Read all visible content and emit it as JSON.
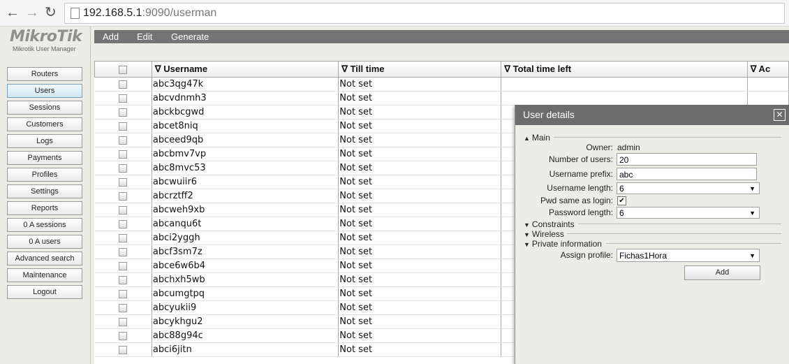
{
  "browser": {
    "back_icon": "arrow-left",
    "forward_icon": "arrow-right",
    "reload_icon": "reload",
    "url_host": "192.168.5.1",
    "url_rest": ":9090/userman"
  },
  "app": {
    "logo": "MikroTik",
    "subtitle": "Mikrotik User Manager"
  },
  "sidebar": {
    "items": [
      {
        "label": "Routers",
        "active": false
      },
      {
        "label": "Users",
        "active": true
      },
      {
        "label": "Sessions",
        "active": false
      },
      {
        "label": "Customers",
        "active": false
      },
      {
        "label": "Logs",
        "active": false
      },
      {
        "label": "Payments",
        "active": false
      },
      {
        "label": "Profiles",
        "active": false
      },
      {
        "label": "Settings",
        "active": false
      },
      {
        "label": "Reports",
        "active": false
      },
      {
        "label": "0 A sessions",
        "active": false
      },
      {
        "label": "0 A users",
        "active": false
      },
      {
        "label": "Advanced search",
        "active": false
      },
      {
        "label": "Maintenance",
        "active": false
      },
      {
        "label": "Logout",
        "active": false
      }
    ]
  },
  "toolbar": {
    "add_label": "Add",
    "edit_label": "Edit",
    "generate_label": "Generate"
  },
  "table": {
    "columns": [
      "∇ Username",
      "∇ Till time",
      "∇ Total time left",
      "∇ Ac"
    ],
    "rows": [
      {
        "username": "abc3qg47k",
        "till_time": "Not set"
      },
      {
        "username": "abcvdnmh3",
        "till_time": "Not set"
      },
      {
        "username": "abckbcgwd",
        "till_time": "Not set"
      },
      {
        "username": "abcet8niq",
        "till_time": "Not set"
      },
      {
        "username": "abceed9qb",
        "till_time": "Not set"
      },
      {
        "username": "abcbmv7vp",
        "till_time": "Not set"
      },
      {
        "username": "abc8mvc53",
        "till_time": "Not set"
      },
      {
        "username": "abcwuiir6",
        "till_time": "Not set"
      },
      {
        "username": "abcrztff2",
        "till_time": "Not set"
      },
      {
        "username": "abcweh9xb",
        "till_time": "Not set"
      },
      {
        "username": "abcanqu6t",
        "till_time": "Not set"
      },
      {
        "username": "abci2yggh",
        "till_time": "Not set"
      },
      {
        "username": "abcf3sm7z",
        "till_time": "Not set"
      },
      {
        "username": "abce6w6b4",
        "till_time": "Not set"
      },
      {
        "username": "abchxh5wb",
        "till_time": "Not set"
      },
      {
        "username": "abcumgtpq",
        "till_time": "Not set"
      },
      {
        "username": "abcyukii9",
        "till_time": "Not set"
      },
      {
        "username": "abcykhgu2",
        "till_time": "Not set"
      },
      {
        "username": "abc88g94c",
        "till_time": "Not set"
      },
      {
        "username": "abci6jitn",
        "till_time": "Not set"
      }
    ]
  },
  "dialog": {
    "title": "User details",
    "close_glyph": "✕",
    "sections": {
      "main": "Main",
      "constraints": "Constraints",
      "wireless": "Wireless",
      "private": "Private information"
    },
    "fields": {
      "owner_label": "Owner:",
      "owner_value": "admin",
      "num_users_label": "Number of users:",
      "num_users_value": "20",
      "prefix_label": "Username prefix:",
      "prefix_value": "abc",
      "uname_len_label": "Username length:",
      "uname_len_value": "6",
      "pwd_same_label": "Pwd same as login:",
      "pwd_same_checked": "✔",
      "pwd_len_label": "Password length:",
      "pwd_len_value": "6",
      "assign_label": "Assign profile:",
      "assign_value": "Fichas1Hora"
    },
    "add_button": "Add"
  }
}
